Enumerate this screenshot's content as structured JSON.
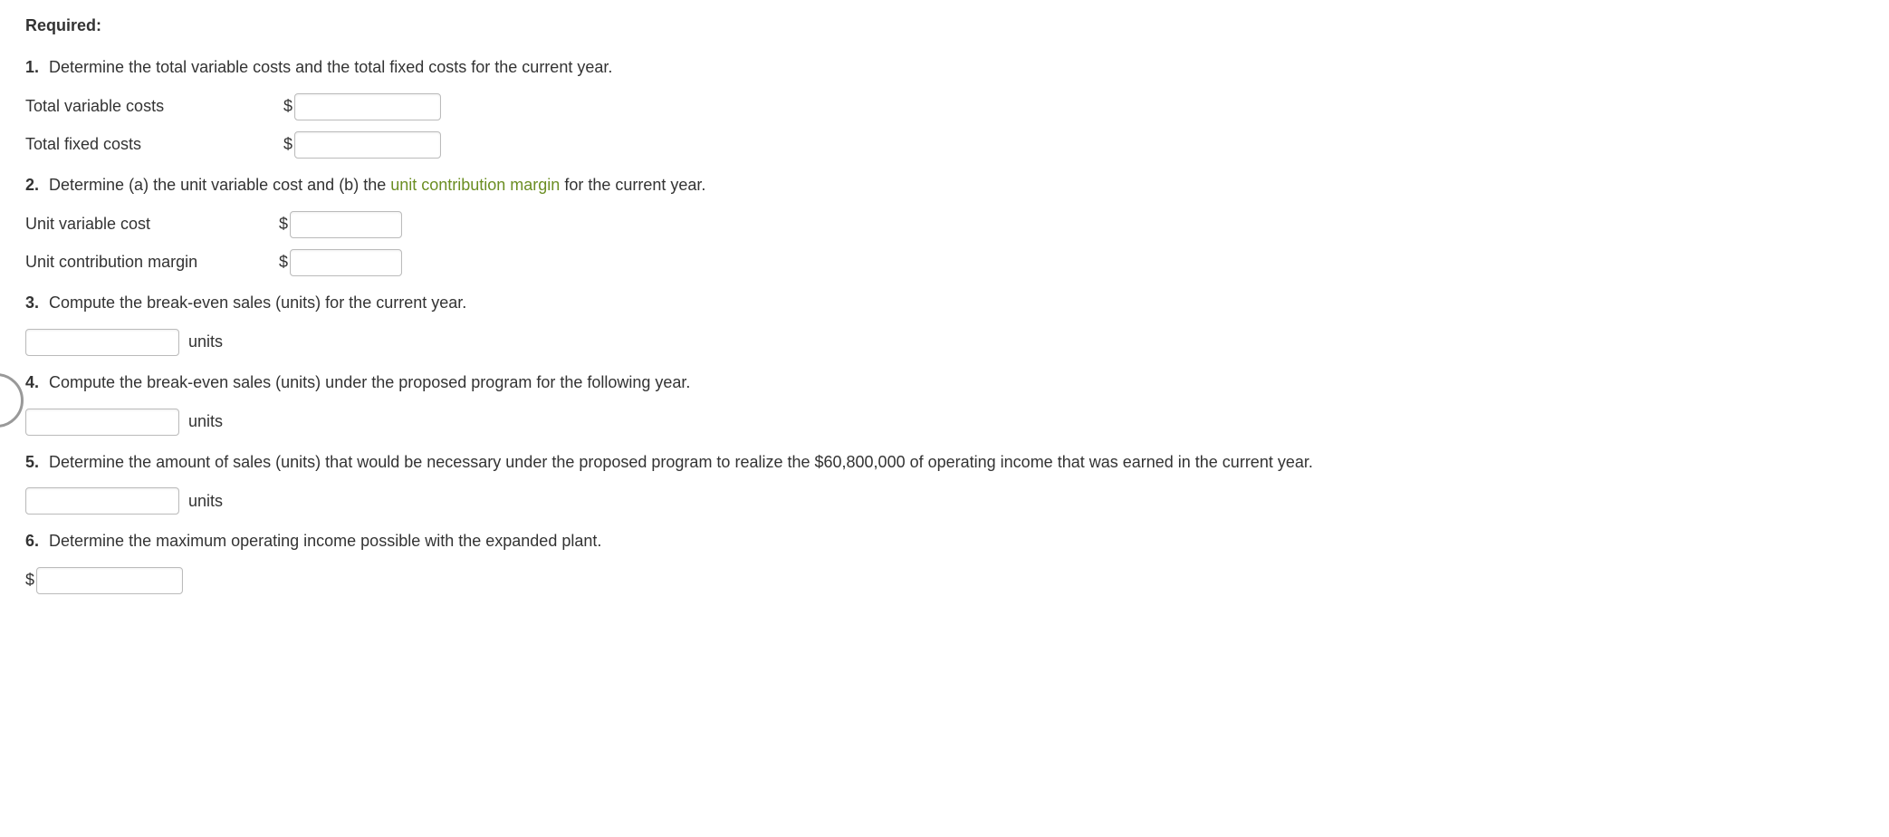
{
  "heading": "Required:",
  "q1": {
    "num": "1.",
    "text": "Determine the total variable costs and the total fixed costs for the current year.",
    "rows": [
      {
        "label": "Total variable costs",
        "prefix": "$",
        "value": ""
      },
      {
        "label": "Total fixed costs",
        "prefix": "$",
        "value": ""
      }
    ]
  },
  "q2": {
    "num": "2.",
    "text_pre": "Determine (a) the unit variable cost and (b) the ",
    "link": "unit contribution margin",
    "text_post": " for the current year.",
    "rows": [
      {
        "label": "Unit variable cost",
        "prefix": "$",
        "value": ""
      },
      {
        "label": "Unit contribution margin",
        "prefix": "$",
        "value": ""
      }
    ]
  },
  "q3": {
    "num": "3.",
    "text": "Compute the break-even sales (units) for the current year.",
    "value": "",
    "suffix": "units"
  },
  "q4": {
    "num": "4.",
    "text": "Compute the break-even sales (units) under the proposed program for the following year.",
    "value": "",
    "suffix": "units"
  },
  "q5": {
    "num": "5.",
    "text": "Determine the amount of sales (units) that would be necessary under the proposed program to realize the $60,800,000 of operating income that was earned in the current year.",
    "value": "",
    "suffix": "units"
  },
  "q6": {
    "num": "6.",
    "text": "Determine the maximum operating income possible with the expanded plant.",
    "prefix": "$",
    "value": ""
  }
}
